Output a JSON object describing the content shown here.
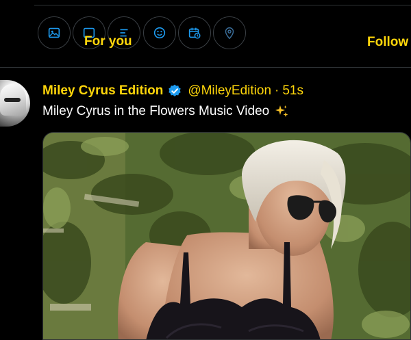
{
  "tabs": {
    "for_you": "For you",
    "following": "Follow"
  },
  "composer_tools": [
    {
      "icon": "image-icon"
    },
    {
      "icon": "gif-icon"
    },
    {
      "icon": "poll-icon"
    },
    {
      "icon": "emoji-icon"
    },
    {
      "icon": "schedule-icon"
    },
    {
      "icon": "location-icon"
    }
  ],
  "post": {
    "author_name": "Miley Cyrus Edition",
    "verified": true,
    "handle": "@MileyEdition",
    "separator": "·",
    "timestamp": "51s",
    "text": "Miley Cyrus in the Flowers Music Video",
    "text_emoji": "sparkles-icon",
    "media": {
      "kind": "photo"
    }
  },
  "colors": {
    "background": "#000000",
    "accent_text": "#ffd60a",
    "verified_badge": "#1d9bf0",
    "icon_outline": "#1d9bf0",
    "divider": "#2f3336"
  }
}
